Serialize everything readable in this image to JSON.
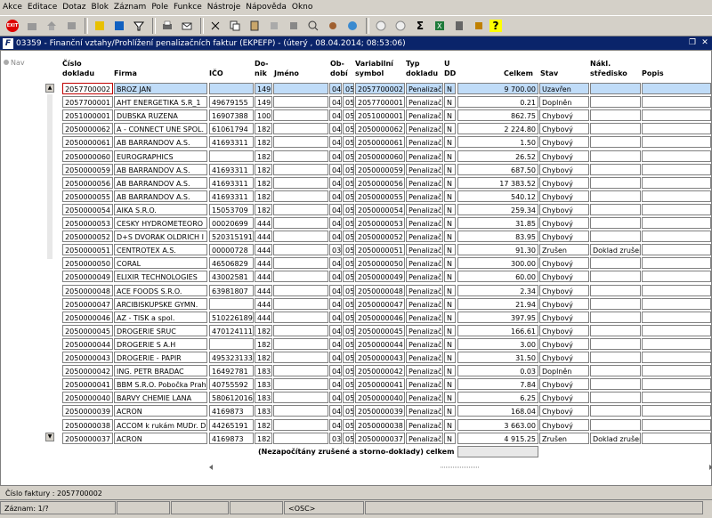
{
  "menu": [
    {
      "label": "Akce"
    },
    {
      "label": "Editace"
    },
    {
      "label": "Dotaz"
    },
    {
      "label": "Blok"
    },
    {
      "label": "Záznam"
    },
    {
      "label": "Pole"
    },
    {
      "label": "Funkce"
    },
    {
      "label": "Nástroje"
    },
    {
      "label": "Nápověda"
    },
    {
      "label": "Okno"
    }
  ],
  "toolbar": {
    "exit_label": "EXIT",
    "icons": [
      "exit-icon",
      "open-icon",
      "home-icon",
      "flag-icon",
      "next-icon",
      "add-icon",
      "filter-icon",
      "print-icon",
      "mail-icon",
      "cut-icon",
      "copy-icon",
      "paste-icon",
      "refresh-icon",
      "help-icon",
      "zoom-icon",
      "gear-icon",
      "world-icon",
      "back-icon",
      "forward-icon",
      "sum-icon",
      "excel-icon",
      "calculator-icon",
      "question-icon"
    ],
    "sum_glyph": "Σ",
    "question_glyph": "?"
  },
  "window": {
    "title": "03359 - Finanční vztahy/Prohlížení penalizačních faktur (EKPEFP) - (úterý , 08.04.2014; 08:53:06)",
    "logo": "F"
  },
  "nav_label": "Nav",
  "columns": {
    "cislo": "Číslo\ndokladu",
    "firma": "Firma",
    "ico": "IČO",
    "do": "Do-\nnik",
    "jmeno": "Jméno",
    "ob": "Ob-\ndobí",
    "var": "Variabilní\nsymbol",
    "typ": "Typ\ndokladu",
    "ud": "U\nDD",
    "celkem": "Celkem",
    "stav": "Stav",
    "stredisko": "Nákl.\nstředisko",
    "popis": "Popis"
  },
  "rows": [
    [
      "2057700002",
      "BROZ JAN",
      "",
      "149",
      "",
      "04",
      "05",
      "2057700002",
      "Penalizač",
      "N",
      "9 700.00",
      "Uzavřen",
      ""
    ],
    [
      "2057700001",
      "AHT ENERGETIKA S.R_1",
      "49679155",
      "149",
      "",
      "04",
      "05",
      "2057700001",
      "Penalizač",
      "N",
      "0.21",
      "Doplněn",
      ""
    ],
    [
      "2051000001",
      "DUBSKA RUZENA",
      "16907388",
      "100",
      "",
      "04",
      "05",
      "2051000001",
      "Penalizač",
      "N",
      "862.75",
      "Chybový",
      ""
    ],
    [
      "2050000062",
      "A - CONNECT UNE SPOL.",
      "61061794",
      "182",
      "",
      "04",
      "05",
      "2050000062",
      "Penalizač",
      "N",
      "2 224.80",
      "Chybový",
      ""
    ],
    [
      "2050000061",
      "AB BARRANDOV A.S.",
      "41693311",
      "182",
      "",
      "04",
      "05",
      "2050000061",
      "Penalizač",
      "N",
      "1.50",
      "Chybový",
      ""
    ],
    [
      "2050000060",
      "EUROGRAPHICS",
      "",
      "182",
      "",
      "04",
      "05",
      "2050000060",
      "Penalizač",
      "N",
      "26.52",
      "Chybový",
      ""
    ],
    [
      "2050000059",
      "AB BARRANDOV A.S.",
      "41693311",
      "182",
      "",
      "04",
      "05",
      "2050000059",
      "Penalizač",
      "N",
      "687.50",
      "Chybový",
      ""
    ],
    [
      "2050000056",
      "AB BARRANDOV A.S.",
      "41693311",
      "182",
      "",
      "04",
      "05",
      "2050000056",
      "Penalizač",
      "N",
      "17 383.52",
      "Chybový",
      ""
    ],
    [
      "2050000055",
      "AB BARRANDOV A.S.",
      "41693311",
      "182",
      "",
      "04",
      "05",
      "2050000055",
      "Penalizač",
      "N",
      "540.12",
      "Chybový",
      ""
    ],
    [
      "2050000054",
      "AIKA S.R.O.",
      "15053709",
      "182",
      "",
      "04",
      "05",
      "2050000054",
      "Penalizač",
      "N",
      "259.34",
      "Chybový",
      ""
    ],
    [
      "2050000053",
      "CESKY HYDROMETEORO",
      "00020699",
      "444",
      "",
      "04",
      "05",
      "2050000053",
      "Penalizač",
      "N",
      "31.85",
      "Chybový",
      ""
    ],
    [
      "2050000052",
      "D+S DVORAK OLDRICH I",
      "520315191",
      "444",
      "",
      "04",
      "05",
      "2050000052",
      "Penalizač",
      "N",
      "83.95",
      "Chybový",
      ""
    ],
    [
      "2050000051",
      "CENTROTEX A.S.",
      "00000728",
      "444",
      "",
      "03",
      "05",
      "2050000051",
      "Penalizač",
      "N",
      "91.30",
      "Zrušen",
      "Doklad zrušen"
    ],
    [
      "2050000050",
      "CORAL",
      "46506829",
      "444",
      "",
      "04",
      "05",
      "2050000050",
      "Penalizač",
      "N",
      "300.00",
      "Chybový",
      ""
    ],
    [
      "2050000049",
      "ELIXIR TECHNOLOGIES",
      "43002581",
      "444",
      "",
      "04",
      "05",
      "2050000049",
      "Penalizač",
      "N",
      "60.00",
      "Chybový",
      ""
    ],
    [
      "2050000048",
      "ACE FOODS S.R.O.",
      "63981807",
      "444",
      "",
      "04",
      "05",
      "2050000048",
      "Penalizač",
      "N",
      "2.34",
      "Chybový",
      ""
    ],
    [
      "2050000047",
      "ARCIBISKUPSKE GYMN.",
      "",
      "444",
      "",
      "04",
      "05",
      "2050000047",
      "Penalizač",
      "N",
      "21.94",
      "Chybový",
      ""
    ],
    [
      "2050000046",
      "AZ - TISK a spol.",
      "510226189",
      "444",
      "",
      "04",
      "05",
      "2050000046",
      "Penalizač",
      "N",
      "397.95",
      "Chybový",
      ""
    ],
    [
      "2050000045",
      "DROGERIE SRUC",
      "470124111",
      "182",
      "",
      "04",
      "05",
      "2050000045",
      "Penalizač",
      "N",
      "166.61",
      "Chybový",
      ""
    ],
    [
      "2050000044",
      "DROGERIE S A.H",
      "",
      "182",
      "",
      "04",
      "05",
      "2050000044",
      "Penalizač",
      "N",
      "3.00",
      "Chybový",
      ""
    ],
    [
      "2050000043",
      "DROGERIE - PAPIR",
      "495323133",
      "182",
      "",
      "04",
      "05",
      "2050000043",
      "Penalizač",
      "N",
      "31.50",
      "Chybový",
      ""
    ],
    [
      "2050000042",
      "ING. PETR BRADAC",
      "16492781",
      "183",
      "",
      "04",
      "05",
      "2050000042",
      "Penalizač",
      "N",
      "0.03",
      "Doplněn",
      ""
    ],
    [
      "2050000041",
      "BBM S.R.O. Pobočka Prah",
      "40755592",
      "183",
      "",
      "04",
      "05",
      "2050000041",
      "Penalizač",
      "N",
      "7.84",
      "Chybový",
      ""
    ],
    [
      "2050000040",
      "BARVY CHEMIE LANA",
      "5806120166",
      "183",
      "",
      "04",
      "05",
      "2050000040",
      "Penalizač",
      "N",
      "6.25",
      "Chybový",
      ""
    ],
    [
      "2050000039",
      "ACRON",
      "4169873",
      "183",
      "",
      "04",
      "05",
      "2050000039",
      "Penalizač",
      "N",
      "168.04",
      "Chybový",
      ""
    ],
    [
      "2050000038",
      "ACCOM k rukám MUDr. D.",
      "44265191",
      "182",
      "",
      "04",
      "05",
      "2050000038",
      "Penalizač",
      "N",
      "3 663.00",
      "Chybový",
      ""
    ],
    [
      "2050000037",
      "ACRON",
      "4169873",
      "182",
      "",
      "03",
      "05",
      "2050000037",
      "Penalizač",
      "N",
      "4 915.25",
      "Zrušen",
      "Doklad zrušen"
    ]
  ],
  "footer_label": "(Nezapočítány zrušené a storno-doklady) celkem",
  "status": {
    "line1": "Číslo faktury : 2057700002",
    "record": "Záznam: 1/?",
    "mode": "<OSC>"
  },
  "colors": {
    "title_bg": "#0a246a",
    "selected": "#c0dcf8",
    "highlight": "#c00000"
  }
}
